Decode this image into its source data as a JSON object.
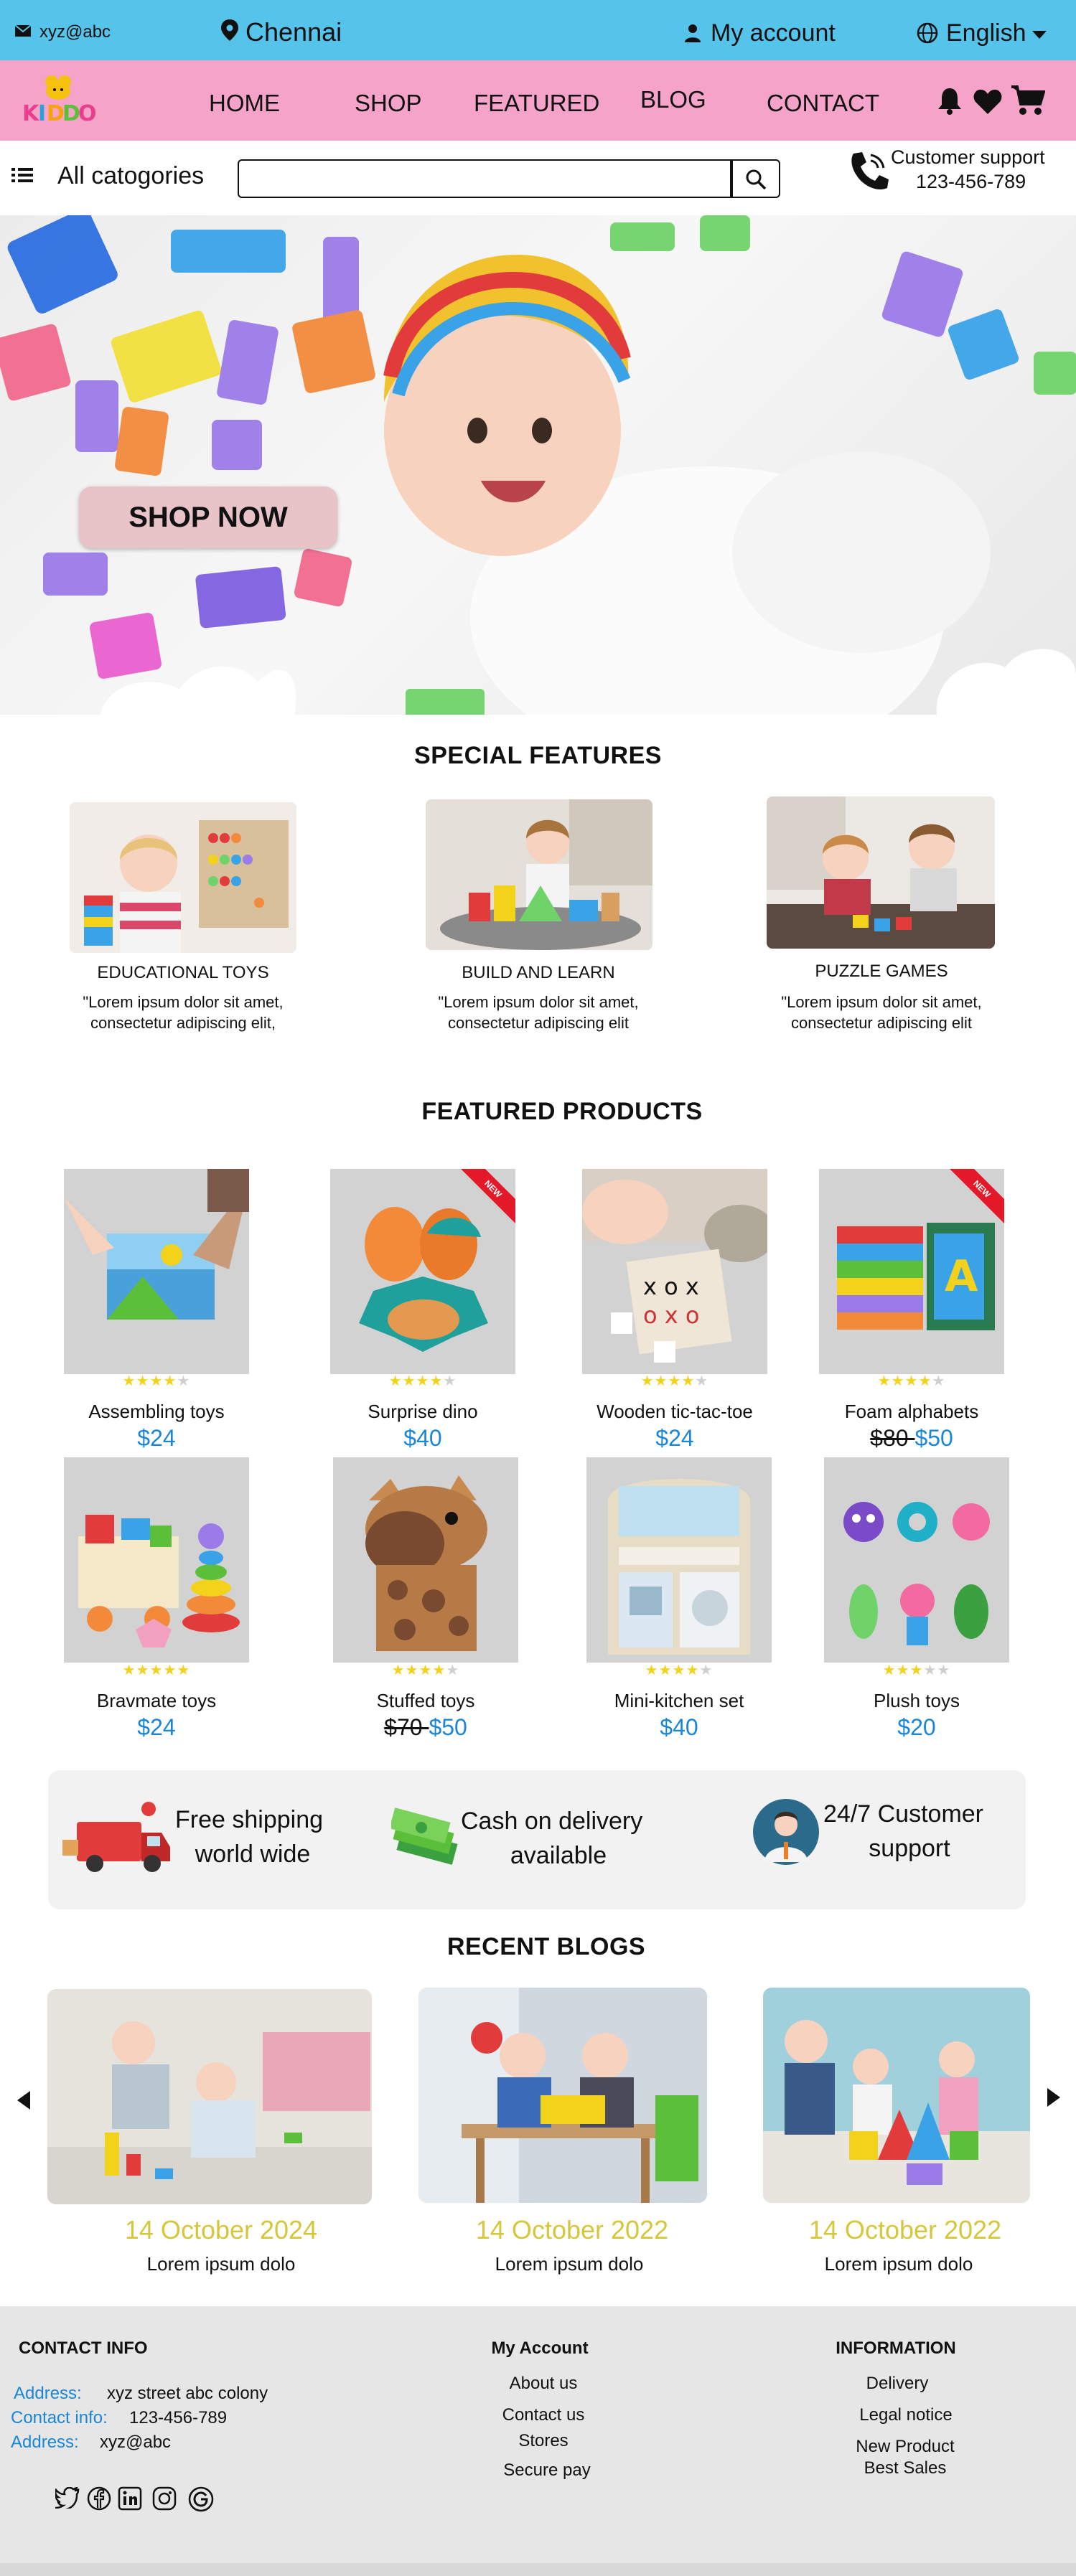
{
  "topbar": {
    "email": "xyz@abc",
    "location": "Chennai",
    "account": "My account",
    "language": "English"
  },
  "brand": {
    "logo_text": "KIDDO"
  },
  "nav": {
    "items": [
      "HOME",
      "SHOP",
      "FEATURED",
      "BLOG",
      "CONTACT"
    ]
  },
  "search": {
    "categories_label": "All catogories",
    "placeholder": "",
    "support_title": "Customer support",
    "support_phone": "123-456-789"
  },
  "hero": {
    "cta_label": "SHOP NOW"
  },
  "special_features": {
    "title": "SPECIAL FEATURES",
    "items": [
      {
        "title": "EDUCATIONAL TOYS",
        "line1": "\"Lorem ipsum dolor sit amet,",
        "line2": "consectetur adipiscing elit,"
      },
      {
        "title": "BUILD AND LEARN",
        "line1": "\"Lorem ipsum dolor sit amet,",
        "line2": "consectetur adipiscing elit"
      },
      {
        "title": "PUZZLE GAMES",
        "line1": "\"Lorem ipsum dolor sit amet,",
        "line2": "consectetur adipiscing elit"
      }
    ]
  },
  "featured": {
    "title": "FEATURED PRODUCTS",
    "new_badge": "NEW",
    "products": [
      {
        "name": "Assembling toys",
        "price": "$24",
        "old_price": "",
        "rating": 4
      },
      {
        "name": "Surprise dino",
        "price": "$40",
        "old_price": "",
        "rating": 4
      },
      {
        "name": "Wooden tic-tac-toe",
        "price": "$24",
        "old_price": "",
        "rating": 4
      },
      {
        "name": "Foam alphabets",
        "price": "$50",
        "old_price": "$80",
        "rating": 4
      },
      {
        "name": "Bravmate toys",
        "price": "$24",
        "old_price": "",
        "rating": 5
      },
      {
        "name": "Stuffed toys",
        "price": "$50",
        "old_price": "$70",
        "rating": 4
      },
      {
        "name": "Mini-kitchen set",
        "price": "$40",
        "old_price": "",
        "rating": 4
      },
      {
        "name": "Plush toys",
        "price": "$20",
        "old_price": "",
        "rating": 3
      }
    ]
  },
  "benefits": [
    {
      "line1": "Free shipping",
      "line2": "world wide"
    },
    {
      "line1": "Cash on delivery",
      "line2": "available"
    },
    {
      "line1": "24/7 Customer",
      "line2": "support"
    }
  ],
  "blogs": {
    "title": "RECENT BLOGS",
    "items": [
      {
        "date": "14 October 2024",
        "text": "Lorem ipsum dolo"
      },
      {
        "date": "14 October 2022",
        "text": "Lorem ipsum dolo"
      },
      {
        "date": "14 October 2022",
        "text": "Lorem ipsum dolo"
      }
    ]
  },
  "footer": {
    "contact_title": "CONTACT INFO",
    "address_label": "Address:",
    "address_value": "xyz street abc colony",
    "contact_label": "Contact info:",
    "contact_value": "123-456-789",
    "address2_label": "Address:",
    "address2_value": "xyz@abc",
    "account_title": "My Account",
    "account_links": [
      "About us",
      "Contact us",
      "Stores",
      "Secure pay"
    ],
    "info_title": "INFORMATION",
    "info_links": [
      "Delivery",
      "Legal notice",
      "New Product",
      "Best Sales"
    ]
  },
  "colors": {
    "topbar": "#56c3ea",
    "navbar": "#f5a3c9",
    "accent_blue": "#1a86d6",
    "date_yellow": "#d4c73c",
    "star": "#f2d21b"
  }
}
